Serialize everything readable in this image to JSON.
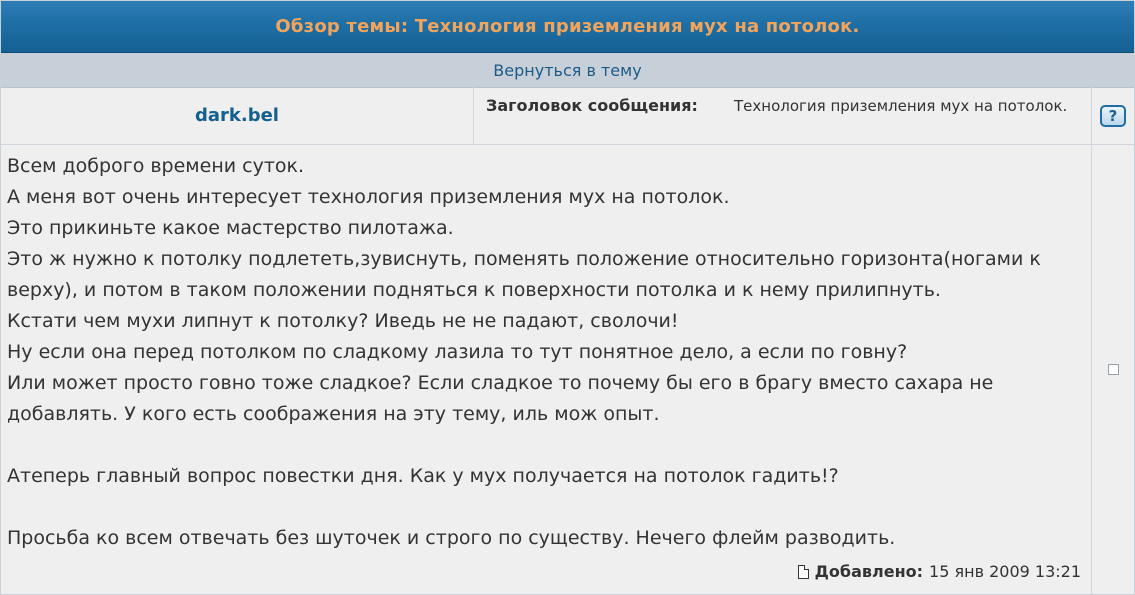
{
  "header": {
    "title": "Обзор темы: Технология приземления мух на потолок."
  },
  "nav": {
    "back_link": "Вернуться в тему"
  },
  "post": {
    "author": "dark.bel",
    "subject_label": "Заголовок сообщения:",
    "subject": "Технология приземления мух на потолок.",
    "help_label": "?",
    "lines": [
      "Всем доброго времени суток.",
      "А меня вот очень интересует технология приземления мух на потолок.",
      "Это прикиньте какое мастерство пилотажа.",
      "Это ж нужно к потолку подлететь,зувиснуть, поменять положение относительно горизонта(ногами к верху), и потом в таком положении подняться к поверхности потолка и к нему прилипнуть.",
      "Кстати чем мухи липнут к потолку? Иведь не не падают, сволочи!",
      "Ну если она перед потолком по сладкому лазила то тут понятное дело, а если по говну?",
      "Или может просто говно тоже сладкое? Если сладкое то почему бы его в брагу вместо сахара не добавлять. У кого есть соображения на эту тему, иль мож опыт.",
      "",
      "Атеперь главный вопрос повестки дня. Как у мух получается на потолок гадить!?",
      "",
      "Просьба ко всем отвечать без шуточек и строго по существу. Нечего флейм разводить."
    ],
    "posted_label": "Добавлено:",
    "posted_date": "15 янв 2009 13:21",
    "posted_icon": "document-icon",
    "select_checked": false
  },
  "colors": {
    "header_bg": "#1e6fa6",
    "header_text": "#f2a45a",
    "link": "#1d5a89",
    "author": "#13608f",
    "panel_bg": "#efefef",
    "nav_bg": "#c7d0d8"
  }
}
